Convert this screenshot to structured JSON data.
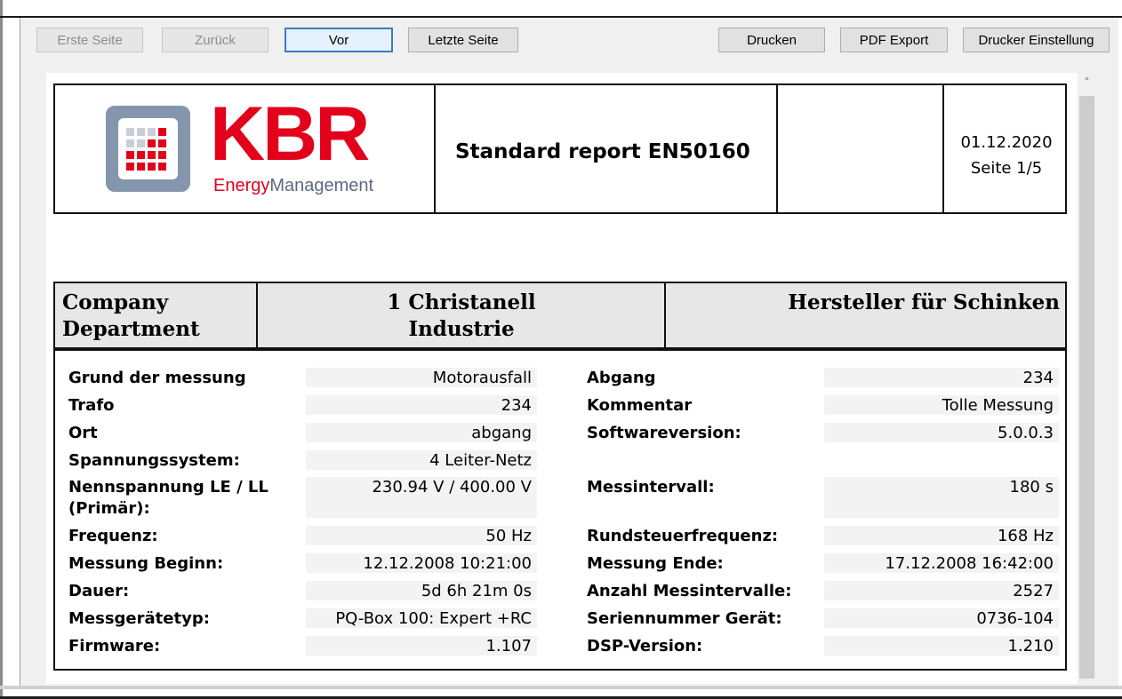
{
  "toolbar": {
    "first_page": "Erste Seite",
    "back": "Zurück",
    "next": "Vor",
    "last_page": "Letzte Seite",
    "print": "Drucken",
    "pdf_export": "PDF Export",
    "printer_settings": "Drucker Einstellung"
  },
  "report": {
    "logo": {
      "text": "KBR",
      "tagline_energy": "Energy",
      "tagline_management": "Management"
    },
    "title": "Standard report EN50160",
    "date": "01.12.2020",
    "page": "Seite 1/5",
    "company_label_1": "Company",
    "company_label_2": "Department",
    "company_name_1": "1 Christanell",
    "company_name_2": "Industrie",
    "department_name": "Hersteller für Schinken",
    "left_fields": [
      {
        "label": "Grund der messung",
        "value": "Motorausfall"
      },
      {
        "label": "Trafo",
        "value": "234"
      },
      {
        "label": "Ort",
        "value": "abgang"
      },
      {
        "label": "Spannungssystem:",
        "value": "4 Leiter-Netz"
      },
      {
        "label": "Nennspannung LE / LL",
        "label2": "(Primär):",
        "value": "230.94 V / 400.00 V"
      },
      {
        "label": "Frequenz:",
        "value": "50 Hz"
      },
      {
        "label": "Messung Beginn:",
        "value": "12.12.2008 10:21:00"
      },
      {
        "label": "Dauer:",
        "value": "5d 6h 21m 0s"
      },
      {
        "label": "Messgerätetyp:",
        "value": "PQ-Box 100: Expert +RC"
      },
      {
        "label": "Firmware:",
        "value": "1.107"
      }
    ],
    "right_fields": [
      {
        "label": "Abgang",
        "value": "234"
      },
      {
        "label": "Kommentar",
        "value": "Tolle Messung"
      },
      {
        "label": "Softwareversion:",
        "value": "5.0.0.3"
      },
      {
        "label": "Messintervall:",
        "value": "180 s"
      },
      {
        "label": "Rundsteuerfrequenz:",
        "value": "168 Hz"
      },
      {
        "label": "Messung Ende:",
        "value": "17.12.2008 16:42:00"
      },
      {
        "label": "Anzahl Messintervalle:",
        "value": "2527"
      },
      {
        "label": "Seriennummer Gerät:",
        "value": "0736-104"
      },
      {
        "label": "DSP-Version:",
        "value": "1.210"
      }
    ]
  },
  "colors": {
    "kbr_red": "#e2001a",
    "logo_blue_gray": "#8496ac",
    "section_gray": "#e7e7e7"
  },
  "icons": {
    "scroll_up": "chevron-up-icon"
  }
}
